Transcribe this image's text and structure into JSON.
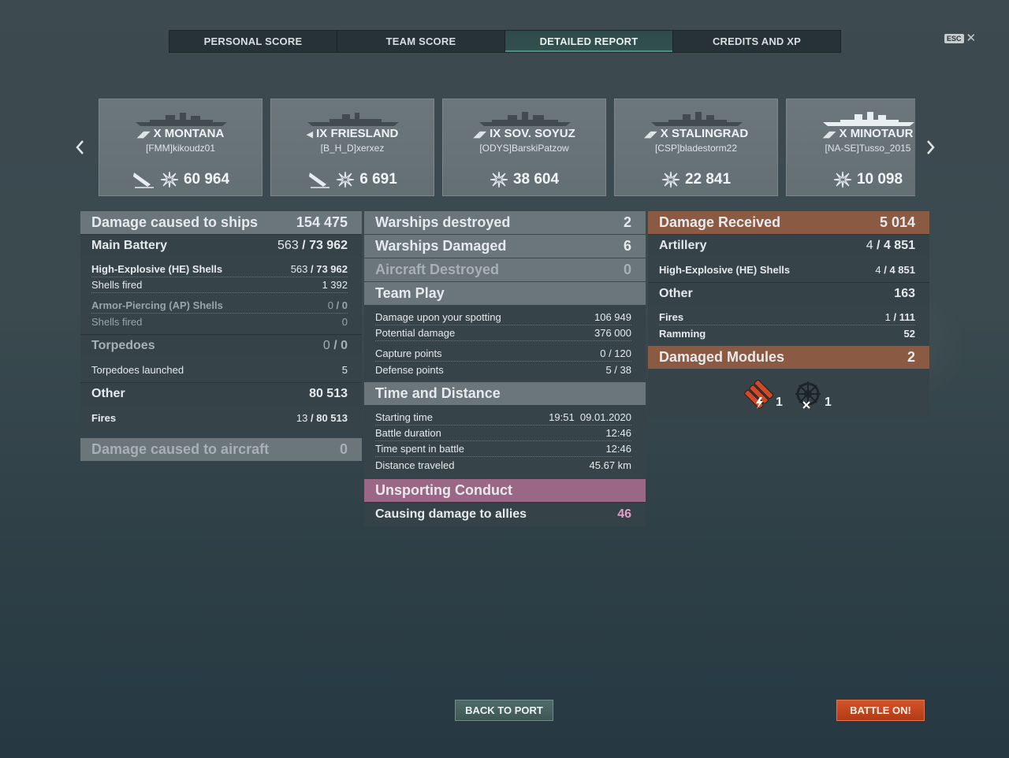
{
  "tabs": [
    "PERSONAL SCORE",
    "TEAM SCORE",
    "DETAILED REPORT",
    "CREDITS AND XP"
  ],
  "active_tab": "DETAILED REPORT",
  "esc": {
    "key": "ESC",
    "close": "✕"
  },
  "nav": {
    "prev": "‹",
    "next": "›"
  },
  "ships": [
    {
      "tier": "X",
      "name": "MONTANA",
      "player": "[FMM]kikoudz01",
      "score": "60 964",
      "class_icon": "battleship-icon",
      "sunk": true
    },
    {
      "tier": "IX",
      "name": "FRIESLAND",
      "player": "[B_H_D]xerxez",
      "score": "6 691",
      "class_icon": "destroyer-icon",
      "sunk": true
    },
    {
      "tier": "IX",
      "name": "SOV. SOYUZ",
      "player": "[ODYS]BarskiPatzow",
      "score": "38 604",
      "class_icon": "battleship-icon",
      "sunk": false
    },
    {
      "tier": "X",
      "name": "STALINGRAD",
      "player": "[CSP]bladestorm22",
      "score": "22 841",
      "class_icon": "cruiser-icon",
      "sunk": false
    },
    {
      "tier": "X",
      "name": "MINOTAUR",
      "player": "[NA-SE]Tusso_2015",
      "score": "10 098",
      "class_icon": "cruiser-icon",
      "sunk": false
    }
  ],
  "left": {
    "title": "Damage caused to ships",
    "total": "154 475",
    "main_battery": {
      "label": "Main Battery",
      "hits": "563",
      "dmg": "73 962"
    },
    "he": {
      "label": "High-Explosive (HE) Shells",
      "hits": "563",
      "dmg": "73 962"
    },
    "he_fired": {
      "label": "Shells fired",
      "value": "1 392"
    },
    "ap": {
      "label": "Armor-Piercing (AP) Shells",
      "hits": "0",
      "dmg": "0"
    },
    "ap_fired": {
      "label": "Shells fired",
      "value": "0"
    },
    "torpedoes": {
      "label": "Torpedoes",
      "hits": "0",
      "dmg": "0"
    },
    "torp_launched": {
      "label": "Torpedoes launched",
      "value": "5"
    },
    "other": {
      "label": "Other",
      "value": "80 513"
    },
    "fires": {
      "label": "Fires",
      "hits": "13",
      "dmg": "80 513"
    },
    "aircraft": {
      "label": "Damage caused to aircraft",
      "value": "0"
    }
  },
  "middle": {
    "destroyed": {
      "label": "Warships destroyed",
      "value": "2"
    },
    "damaged": {
      "label": "Warships Damaged",
      "value": "6"
    },
    "aircraft": {
      "label": "Aircraft Destroyed",
      "value": "0"
    },
    "teamplay": {
      "label": "Team Play"
    },
    "spotting": {
      "label": "Damage upon your spotting",
      "value": "106 949"
    },
    "potential": {
      "label": "Potential damage",
      "value": "376 000"
    },
    "capture": {
      "label": "Capture points",
      "value": "0 / 120"
    },
    "defense": {
      "label": "Defense points",
      "value": "5 / 38"
    },
    "time_title": {
      "label": "Time and Distance"
    },
    "start": {
      "label": "Starting time",
      "value": "19:51  09.01.2020"
    },
    "duration": {
      "label": "Battle duration",
      "value": "12:46"
    },
    "spent": {
      "label": "Time spent in battle",
      "value": "12:46"
    },
    "distance": {
      "label": "Distance traveled",
      "value": "45.67 km"
    },
    "unsporting": {
      "label": "Unsporting Conduct"
    },
    "allies": {
      "label": "Causing damage to allies",
      "value": "46"
    }
  },
  "right": {
    "received": {
      "label": "Damage Received",
      "value": "5 014"
    },
    "artillery": {
      "label": "Artillery",
      "hits": "4",
      "dmg": "4 851"
    },
    "he": {
      "label": "High-Explosive (HE) Shells",
      "hits": "4",
      "dmg": "4 851"
    },
    "other": {
      "label": "Other",
      "value": "163"
    },
    "fires": {
      "label": "Fires",
      "hits": "1",
      "dmg": "111"
    },
    "ramming": {
      "label": "Ramming",
      "value": "52"
    },
    "modules": {
      "label": "Damaged Modules",
      "value": "2"
    },
    "module_items": [
      {
        "icon": "torpedo-tubes-icon",
        "count": "1"
      },
      {
        "icon": "steering-gear-icon",
        "count": "1"
      }
    ]
  },
  "buttons": {
    "back": "BACK TO PORT",
    "battle": "BATTLE ON!"
  },
  "colors": {
    "accent_brown": "#8a5a43",
    "accent_pink": "#9a6786",
    "battle_orange": "#c9471f"
  }
}
